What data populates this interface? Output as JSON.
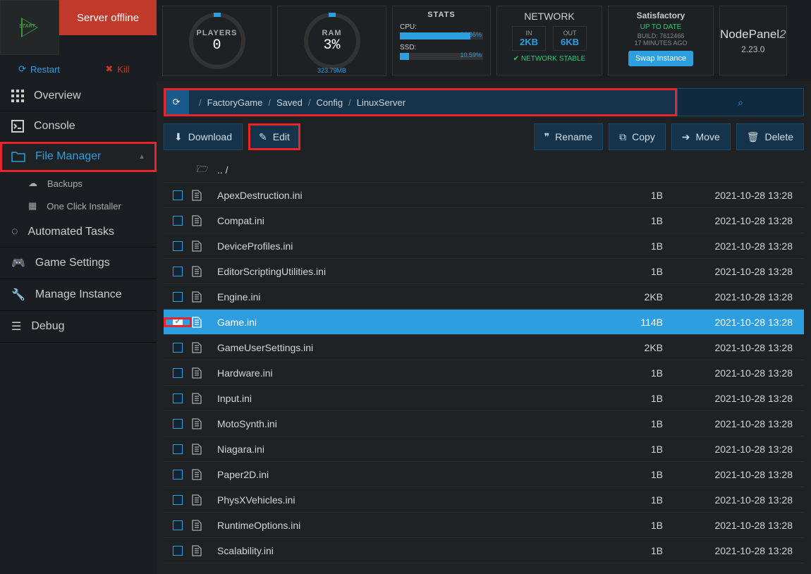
{
  "header": {
    "start_label": "START",
    "server_status": "Server offline",
    "restart": "Restart",
    "kill": "Kill",
    "players": {
      "title": "PLAYERS",
      "value": "0"
    },
    "ram": {
      "title": "RAM",
      "value": "3%",
      "sub": "323.79MB"
    },
    "stats": {
      "title": "STATS",
      "cpu_label": "CPU:",
      "cpu_pct": "84.86%",
      "ssd_label": "SSD:",
      "ssd_pct": "10.59%"
    },
    "network": {
      "title": "NETWORK",
      "in_label": "IN",
      "in_val": "2KB",
      "out_label": "OUT",
      "out_val": "6KB",
      "stable": "NETWORK STABLE"
    },
    "game": {
      "name": "Satisfactory",
      "status": "UP TO DATE",
      "build": "BUILD:  7612466",
      "ago": "17 MINUTES AGO",
      "swap": "Swap Instance"
    },
    "brand": {
      "name": "NodePanel",
      "suffix": "2",
      "version": "2.23.0"
    }
  },
  "sidebar": {
    "items": [
      {
        "label": "Overview"
      },
      {
        "label": "Console"
      },
      {
        "label": "File Manager"
      },
      {
        "label": "Backups"
      },
      {
        "label": "One Click Installer"
      },
      {
        "label": "Automated Tasks"
      },
      {
        "label": "Game Settings"
      },
      {
        "label": "Manage Instance"
      },
      {
        "label": "Debug"
      }
    ]
  },
  "breadcrumb": {
    "segments": [
      "FactoryGame",
      "Saved",
      "Config",
      "LinuxServer"
    ]
  },
  "toolbar": {
    "download": "Download",
    "edit": "Edit",
    "rename": "Rename",
    "copy": "Copy",
    "move": "Move",
    "delete": "Delete"
  },
  "updir": ".. /",
  "files": [
    {
      "name": "ApexDestruction.ini",
      "size": "1B",
      "date": "2021-10-28 13:28",
      "checked": false
    },
    {
      "name": "Compat.ini",
      "size": "1B",
      "date": "2021-10-28 13:28",
      "checked": false
    },
    {
      "name": "DeviceProfiles.ini",
      "size": "1B",
      "date": "2021-10-28 13:28",
      "checked": false
    },
    {
      "name": "EditorScriptingUtilities.ini",
      "size": "1B",
      "date": "2021-10-28 13:28",
      "checked": false
    },
    {
      "name": "Engine.ini",
      "size": "2KB",
      "date": "2021-10-28 13:28",
      "checked": false
    },
    {
      "name": "Game.ini",
      "size": "114B",
      "date": "2021-10-28 13:28",
      "checked": true
    },
    {
      "name": "GameUserSettings.ini",
      "size": "2KB",
      "date": "2021-10-28 13:28",
      "checked": false
    },
    {
      "name": "Hardware.ini",
      "size": "1B",
      "date": "2021-10-28 13:28",
      "checked": false
    },
    {
      "name": "Input.ini",
      "size": "1B",
      "date": "2021-10-28 13:28",
      "checked": false
    },
    {
      "name": "MotoSynth.ini",
      "size": "1B",
      "date": "2021-10-28 13:28",
      "checked": false
    },
    {
      "name": "Niagara.ini",
      "size": "1B",
      "date": "2021-10-28 13:28",
      "checked": false
    },
    {
      "name": "Paper2D.ini",
      "size": "1B",
      "date": "2021-10-28 13:28",
      "checked": false
    },
    {
      "name": "PhysXVehicles.ini",
      "size": "1B",
      "date": "2021-10-28 13:28",
      "checked": false
    },
    {
      "name": "RuntimeOptions.ini",
      "size": "1B",
      "date": "2021-10-28 13:28",
      "checked": false
    },
    {
      "name": "Scalability.ini",
      "size": "1B",
      "date": "2021-10-28 13:28",
      "checked": false
    }
  ]
}
